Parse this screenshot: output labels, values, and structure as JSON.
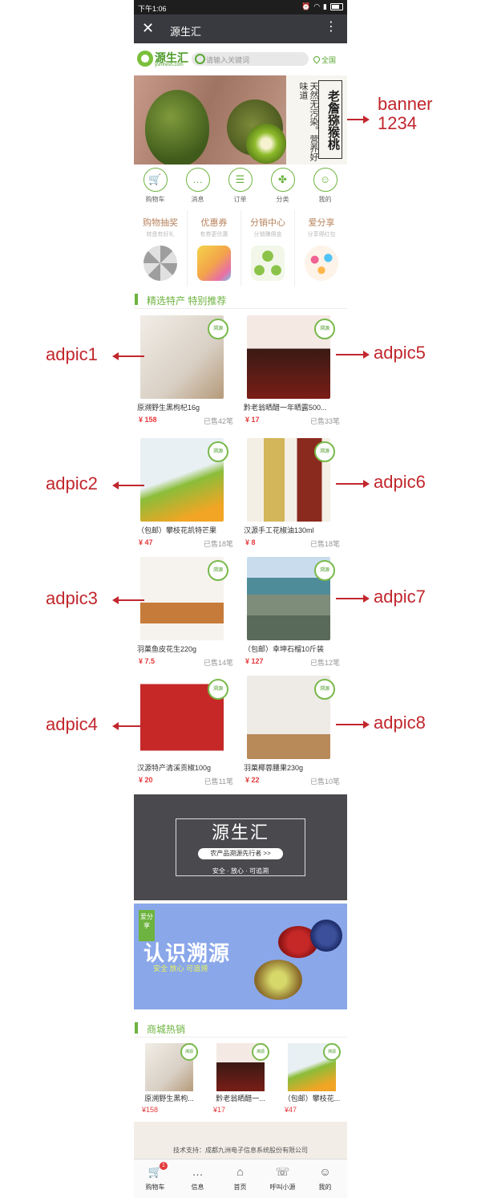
{
  "statusbar": {
    "time": "下午1:06"
  },
  "navbar": {
    "title": "源生汇"
  },
  "header": {
    "logo_cn": "源生汇",
    "logo_en": "yshfresh.com",
    "search_placeholder": "请输入关键词",
    "region": "全国"
  },
  "banner": {
    "slogan": "天然无污染。营养好味道",
    "brand": "老詹猕猴桃"
  },
  "quick_nav": [
    {
      "label": "购物车",
      "icon": "cart-icon"
    },
    {
      "label": "消息",
      "icon": "message-icon"
    },
    {
      "label": "订单",
      "icon": "order-icon"
    },
    {
      "label": "分类",
      "icon": "category-icon"
    },
    {
      "label": "我的",
      "icon": "user-icon"
    }
  ],
  "promos": [
    {
      "title": "购物抽奖",
      "sub": "转盘有好礼"
    },
    {
      "title": "优惠券",
      "sub": "有券更优惠"
    },
    {
      "title": "分销中心",
      "sub": "分销赚佣金"
    },
    {
      "title": "爱分享",
      "sub": "分享得红包"
    }
  ],
  "section_featured": "精选特产 特别推荐",
  "badge_text": "溯源",
  "products": [
    {
      "name": "原溯野生黑枸杞16g",
      "price": "¥ 158",
      "sold": "已售42笔"
    },
    {
      "name": "黔老翁晒醋一年晒露500...",
      "price": "¥ 17",
      "sold": "已售33笔"
    },
    {
      "name": "（包邮）攀枝花凯特芒果",
      "price": "¥ 47",
      "sold": "已售18笔"
    },
    {
      "name": "汉源手工花椒油130ml",
      "price": "¥ 8",
      "sold": "已售18笔"
    },
    {
      "name": "羽菓鱼皮花生220g",
      "price": "¥ 7.5",
      "sold": "已售14笔"
    },
    {
      "name": "（包邮）幸坤石榴10斤装",
      "price": "¥ 127",
      "sold": "已售12笔"
    },
    {
      "name": "汉源特产清溪贡椒100g",
      "price": "¥ 20",
      "sold": "已售11笔"
    },
    {
      "name": "羽菓椰蓉腰果230g",
      "price": "¥ 22",
      "sold": "已售10笔"
    }
  ],
  "ad1": {
    "title": "源生汇",
    "tagline": "农产品溯源先行者 >>",
    "sub": "安全 · 放心 · 可追溯"
  },
  "ad2": {
    "tag": "爱分享",
    "title": "认识溯源",
    "sub": "安全 放心 可追溯"
  },
  "section_hot": "商城热销",
  "hot_products": [
    {
      "name": "原溯野生黑枸...",
      "price": "¥158"
    },
    {
      "name": "黔老翁晒醋一...",
      "price": "¥17"
    },
    {
      "name": "（包邮）攀枝花...",
      "price": "¥47"
    }
  ],
  "footer": {
    "text": "技术支持：成都九洲电子信息系统股份有限公司"
  },
  "tabbar": [
    {
      "label": "购物车",
      "icon": "cart-icon",
      "badge": "1"
    },
    {
      "label": "信息",
      "icon": "chat-icon"
    },
    {
      "label": "首页",
      "icon": "home-icon"
    },
    {
      "label": "呼叫小源",
      "icon": "phone-icon"
    },
    {
      "label": "我的",
      "icon": "user-icon"
    }
  ],
  "annotations": {
    "banner": [
      "banner",
      "1234"
    ],
    "left": [
      "adpic1",
      "adpic2",
      "adpic3",
      "adpic4"
    ],
    "right": [
      "adpic5",
      "adpic6",
      "adpic7",
      "adpic8"
    ]
  },
  "colors": {
    "accent": "#6db33f",
    "price": "#e4393c",
    "annotation": "#c1272d",
    "navbar": "#393a3f"
  }
}
